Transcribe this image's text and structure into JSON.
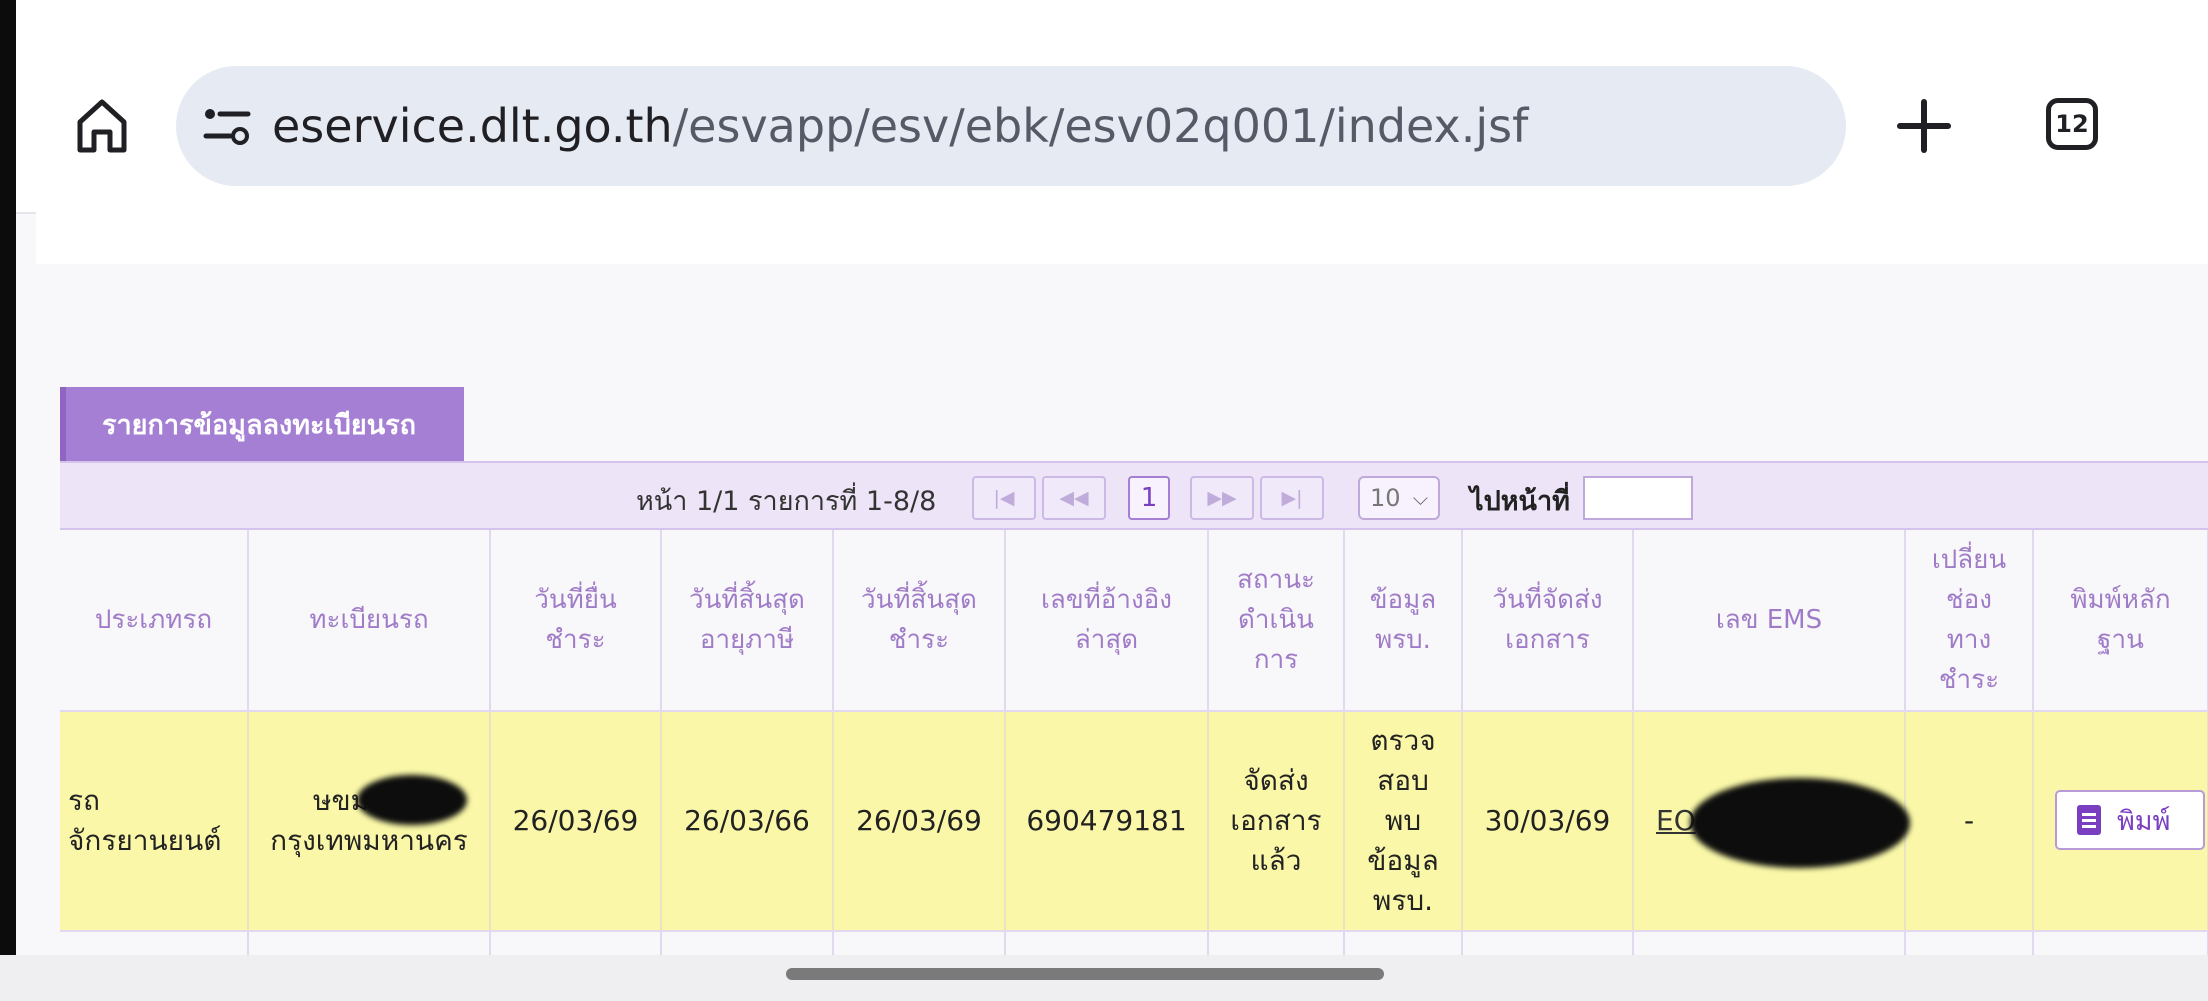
{
  "browser": {
    "url_domain": "eservice.dlt.go.th",
    "url_path": "/esvapp/esv/ebk/esv02q001/index.jsf",
    "tab_count": "12"
  },
  "section": {
    "title": "รายการข้อมูลลงทะเบียนรถ"
  },
  "pager": {
    "info": "หน้า 1/1 รายการที่ 1-8/8",
    "first_icon": "first-page-icon",
    "prev_icon": "previous-page-icon",
    "current_page": "1",
    "next_icon": "next-page-icon",
    "last_icon": "last-page-icon",
    "page_size": "10",
    "goto_label": "ไปหน้าที่"
  },
  "table": {
    "headers": [
      "ประเภทรถ",
      "ทะเบียนรถ",
      "วันที่ยื่นชำระ",
      "วันที่สิ้นสุดอายุภาษี",
      "วันที่สิ้นสุดชำระ",
      "เลขที่อ้างอิงล่าสุด",
      "สถานะดำเนินการ",
      "ข้อมูลพรบ.",
      "วันที่จัดส่งเอกสาร",
      "เลข EMS",
      "เปลี่ยนช่องทางชำระ",
      "พิมพ์หลักฐาน"
    ],
    "header_lines": [
      [
        "ประเภทรถ"
      ],
      [
        "ทะเบียนรถ"
      ],
      [
        "วันที่ยื่น",
        "ชำระ"
      ],
      [
        "วันที่สิ้นสุด",
        "อายุภาษี"
      ],
      [
        "วันที่สิ้นสุด",
        "ชำระ"
      ],
      [
        "เลขที่อ้างอิง",
        "ล่าสุด"
      ],
      [
        "สถานะ",
        "ดำเนิน",
        "การ"
      ],
      [
        "ข้อมูล",
        "พรบ."
      ],
      [
        "วันที่จัดส่ง",
        "เอกสาร"
      ],
      [
        "เลข EMS"
      ],
      [
        "เปลี่ยน",
        "ช่อง",
        "ทาง",
        "ชำระ"
      ],
      [
        "พิมพ์หลัก",
        "ฐาน"
      ]
    ],
    "row": {
      "vehicle_type": [
        "รถ",
        "จักรยานยนต์"
      ],
      "plate": [
        "ษขม",
        "กรุงเทพมหานคร"
      ],
      "submit_date": "26/03/69",
      "tax_expiry": "26/03/66",
      "payment_due": "26/03/69",
      "reference": "690479181",
      "status": [
        "จัดส่ง",
        "เอกสาร",
        "แล้ว"
      ],
      "insurance": [
        "ตรวจ",
        "สอบ",
        "พบ",
        "ข้อมูล",
        "พรบ."
      ],
      "delivery_date": "30/03/69",
      "ems": "EO",
      "change_payment": "-",
      "print_label": "พิมพ์"
    }
  },
  "colors": {
    "accent": "#a57fd3",
    "row_highlight": "#faf8a8",
    "status_green": "#2e9a2e"
  }
}
